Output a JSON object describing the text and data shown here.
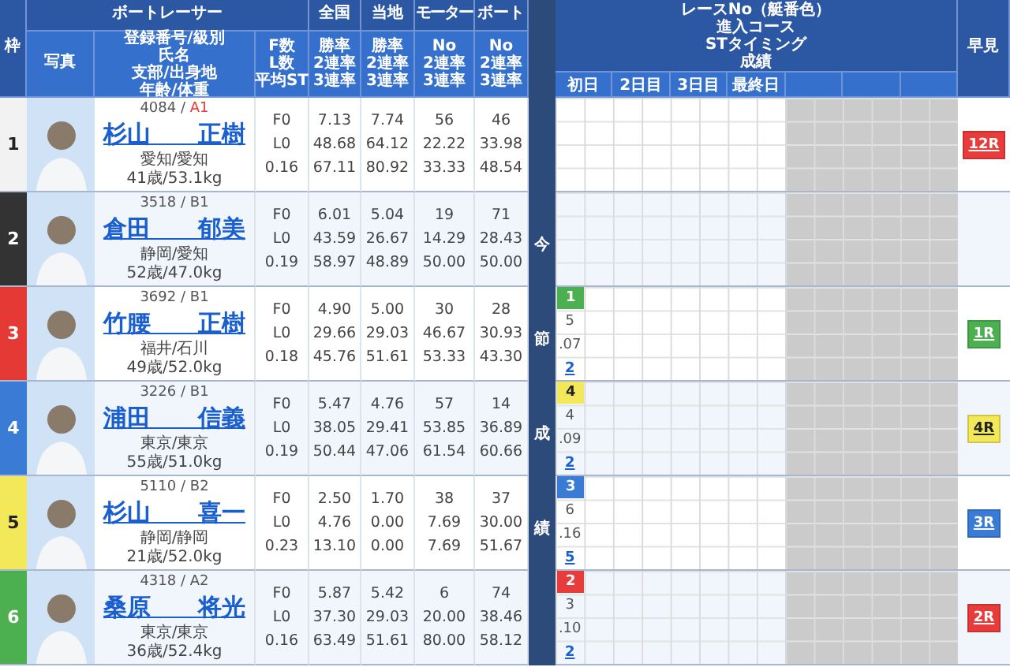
{
  "header": {
    "frame": "枠",
    "racer": "ボートレーサー",
    "photo": "写真",
    "info_lines": [
      "登録番号/級別",
      "氏名",
      "支部/出身地",
      "年齢/体重"
    ],
    "fl_lines": [
      "F数",
      "L数",
      "平均ST"
    ],
    "groups": [
      {
        "title": "全国",
        "lines": [
          "勝率",
          "2連率",
          "3連率"
        ]
      },
      {
        "title": "当地",
        "lines": [
          "勝率",
          "2連率",
          "3連率"
        ]
      },
      {
        "title": "モーター",
        "lines": [
          "No",
          "2連率",
          "3連率"
        ]
      },
      {
        "title": "ボート",
        "lines": [
          "No",
          "2連率",
          "3連率"
        ]
      }
    ],
    "results_lines": [
      "レースNo（艇番色）",
      "進入コース",
      "STタイミング",
      "成績"
    ],
    "days": [
      "初日",
      "2日目",
      "3日目",
      "最終日"
    ],
    "quick": "早見"
  },
  "side_label": "今節成績",
  "rows": [
    {
      "frame": "1",
      "color": "#f2f2f2",
      "reg": "4084 /",
      "class": "A1",
      "class_highlighted": true,
      "name": "杉山　　正樹",
      "branch": "愛知/愛知",
      "age_weight": "41歳/53.1kg",
      "fl": [
        "F0",
        "L0",
        "0.16"
      ],
      "stats": [
        [
          "7.13",
          "48.68",
          "67.11"
        ],
        [
          "7.74",
          "64.12",
          "80.92"
        ],
        [
          "56",
          "22.22",
          "33.33"
        ],
        [
          "46",
          "33.98",
          "48.54"
        ]
      ],
      "quick": {
        "label": "12R",
        "color": "#e83b3b"
      }
    },
    {
      "frame": "2",
      "color": "#333333",
      "reg": "3518 /",
      "class": "B1",
      "class_highlighted": false,
      "name": "倉田　　郁美",
      "branch": "静岡/愛知",
      "age_weight": "52歳/47.0kg",
      "fl": [
        "F0",
        "L0",
        "0.19"
      ],
      "stats": [
        [
          "6.01",
          "43.59",
          "58.97"
        ],
        [
          "5.04",
          "26.67",
          "48.89"
        ],
        [
          "19",
          "14.29",
          "50.00"
        ],
        [
          "71",
          "28.43",
          "50.00"
        ]
      ]
    },
    {
      "frame": "3",
      "color": "#e53935",
      "reg": "3692 /",
      "class": "B1",
      "class_highlighted": false,
      "name": "竹腰　　正樹",
      "branch": "福井/石川",
      "age_weight": "49歳/52.0kg",
      "fl": [
        "F0",
        "L0",
        "0.18"
      ],
      "stats": [
        [
          "4.90",
          "29.66",
          "45.76"
        ],
        [
          "5.00",
          "29.03",
          "51.61"
        ],
        [
          "30",
          "46.67",
          "53.33"
        ],
        [
          "28",
          "30.93",
          "43.30"
        ]
      ],
      "results": [
        {
          "race": "1",
          "color": "#4caf50",
          "course": "5",
          "st": ".07",
          "finish": "2"
        }
      ],
      "quick": {
        "label": "1R",
        "color": "#4caf50"
      }
    },
    {
      "frame": "4",
      "color": "#3a7bd5",
      "reg": "3226 /",
      "class": "B1",
      "class_highlighted": false,
      "name": "浦田　　信義",
      "branch": "東京/東京",
      "age_weight": "55歳/51.0kg",
      "fl": [
        "F0",
        "L0",
        "0.19"
      ],
      "stats": [
        [
          "5.47",
          "38.05",
          "50.44"
        ],
        [
          "4.76",
          "29.41",
          "47.06"
        ],
        [
          "57",
          "53.85",
          "61.54"
        ],
        [
          "14",
          "36.89",
          "60.66"
        ]
      ],
      "results": [
        {
          "race": "4",
          "color": "#f2e85a",
          "course": "4",
          "st": ".09",
          "finish": "2"
        }
      ],
      "quick": {
        "label": "4R",
        "color": "#f2e85a"
      }
    },
    {
      "frame": "5",
      "color": "#f2e85a",
      "reg": "5110 /",
      "class": "B2",
      "class_highlighted": false,
      "name": "杉山　　喜一",
      "branch": "静岡/静岡",
      "age_weight": "21歳/52.0kg",
      "fl": [
        "F0",
        "L0",
        "0.23"
      ],
      "stats": [
        [
          "2.50",
          "4.76",
          "13.10"
        ],
        [
          "1.70",
          "0.00",
          "0.00"
        ],
        [
          "38",
          "7.69",
          "7.69"
        ],
        [
          "37",
          "30.00",
          "51.67"
        ]
      ],
      "results": [
        {
          "race": "3",
          "color": "#3a7bd5",
          "course": "6",
          "st": ".16",
          "finish": "5"
        }
      ],
      "quick": {
        "label": "3R",
        "color": "#3a7bd5"
      }
    },
    {
      "frame": "6",
      "color": "#4caf50",
      "reg": "4318 /",
      "class": "A2",
      "class_highlighted": false,
      "name": "桑原　　将光",
      "branch": "東京/東京",
      "age_weight": "36歳/52.4kg",
      "fl": [
        "F0",
        "L0",
        "0.16"
      ],
      "stats": [
        [
          "5.87",
          "37.30",
          "63.49"
        ],
        [
          "5.42",
          "29.03",
          "51.61"
        ],
        [
          "6",
          "20.00",
          "80.00"
        ],
        [
          "74",
          "38.46",
          "58.12"
        ]
      ],
      "results": [
        {
          "race": "2",
          "color": "#e83b3b",
          "course": "3",
          "st": ".10",
          "finish": "2"
        }
      ],
      "quick": {
        "label": "2R",
        "color": "#e83b3b"
      }
    }
  ]
}
